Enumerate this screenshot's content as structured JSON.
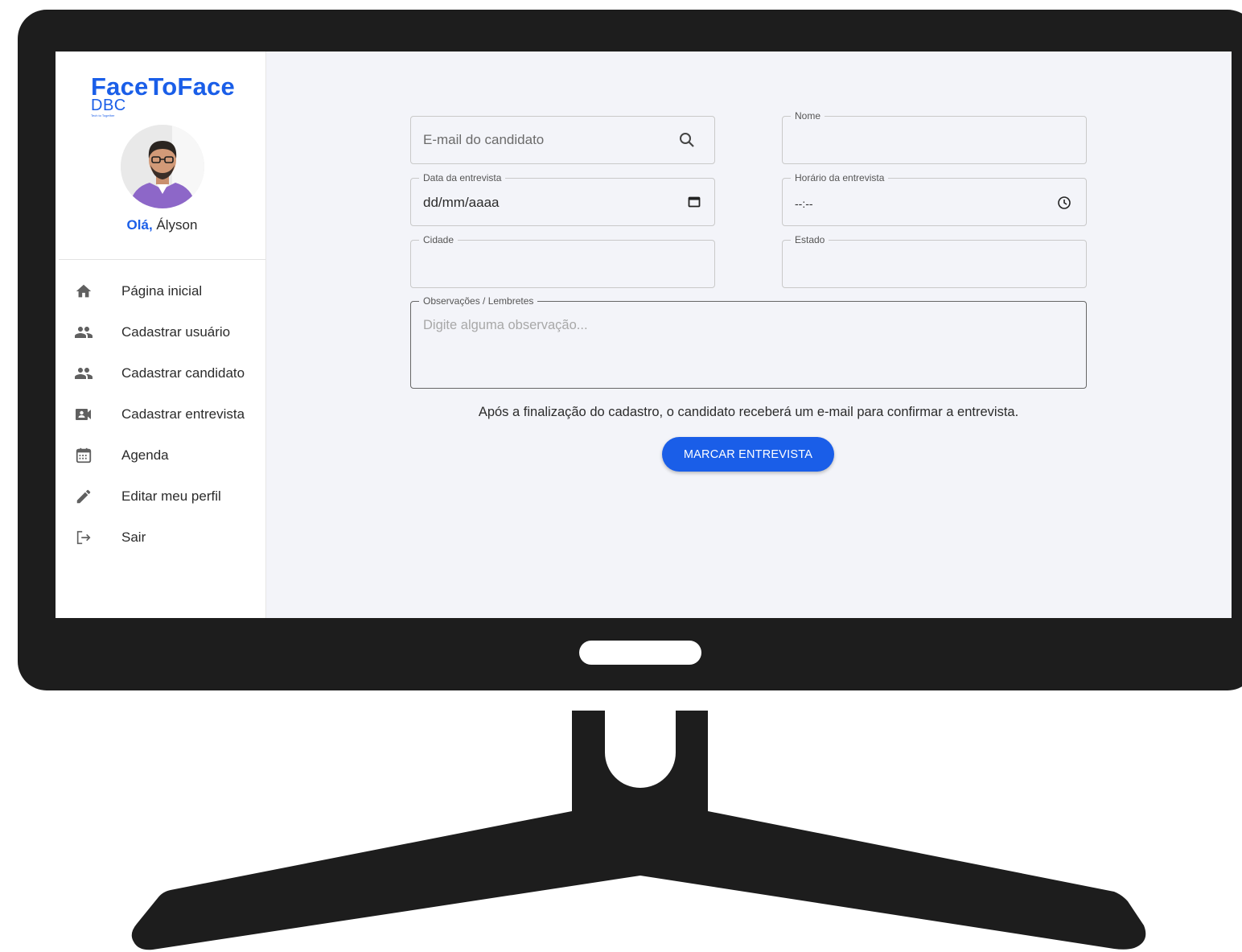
{
  "brand": {
    "name": "FaceToFace",
    "sub": "DBC",
    "tagline": "Tech to Together"
  },
  "user": {
    "greeting_prefix": "Olá,",
    "name": "Ályson"
  },
  "sidebar": {
    "items": [
      {
        "label": "Página inicial",
        "icon": "home-icon"
      },
      {
        "label": "Cadastrar usuário",
        "icon": "people-icon"
      },
      {
        "label": "Cadastrar candidato",
        "icon": "people-icon"
      },
      {
        "label": "Cadastrar entrevista",
        "icon": "video-icon"
      },
      {
        "label": "Agenda",
        "icon": "calendar-icon"
      },
      {
        "label": "Editar meu perfil",
        "icon": "pencil-icon"
      },
      {
        "label": "Sair",
        "icon": "logout-icon"
      }
    ]
  },
  "form": {
    "email": {
      "placeholder": "E-mail do candidato"
    },
    "nome": {
      "label": "Nome",
      "value": ""
    },
    "data": {
      "label": "Data da entrevista",
      "value": "dd/mm/aaaa"
    },
    "horario": {
      "label": "Horário da entrevista",
      "value": "--:--"
    },
    "cidade": {
      "label": "Cidade",
      "value": ""
    },
    "estado": {
      "label": "Estado",
      "value": ""
    },
    "observacoes": {
      "label": "Observações / Lembretes",
      "placeholder": "Digite alguma observação..."
    },
    "note": "Após a finalização do cadastro, o candidato receberá um e-mail para confirmar a entrevista.",
    "submit_label": "MARCAR ENTREVISTA"
  },
  "colors": {
    "accent": "#1a5ee8",
    "frame": "#1d1d1d",
    "background": "#f3f4f9"
  }
}
